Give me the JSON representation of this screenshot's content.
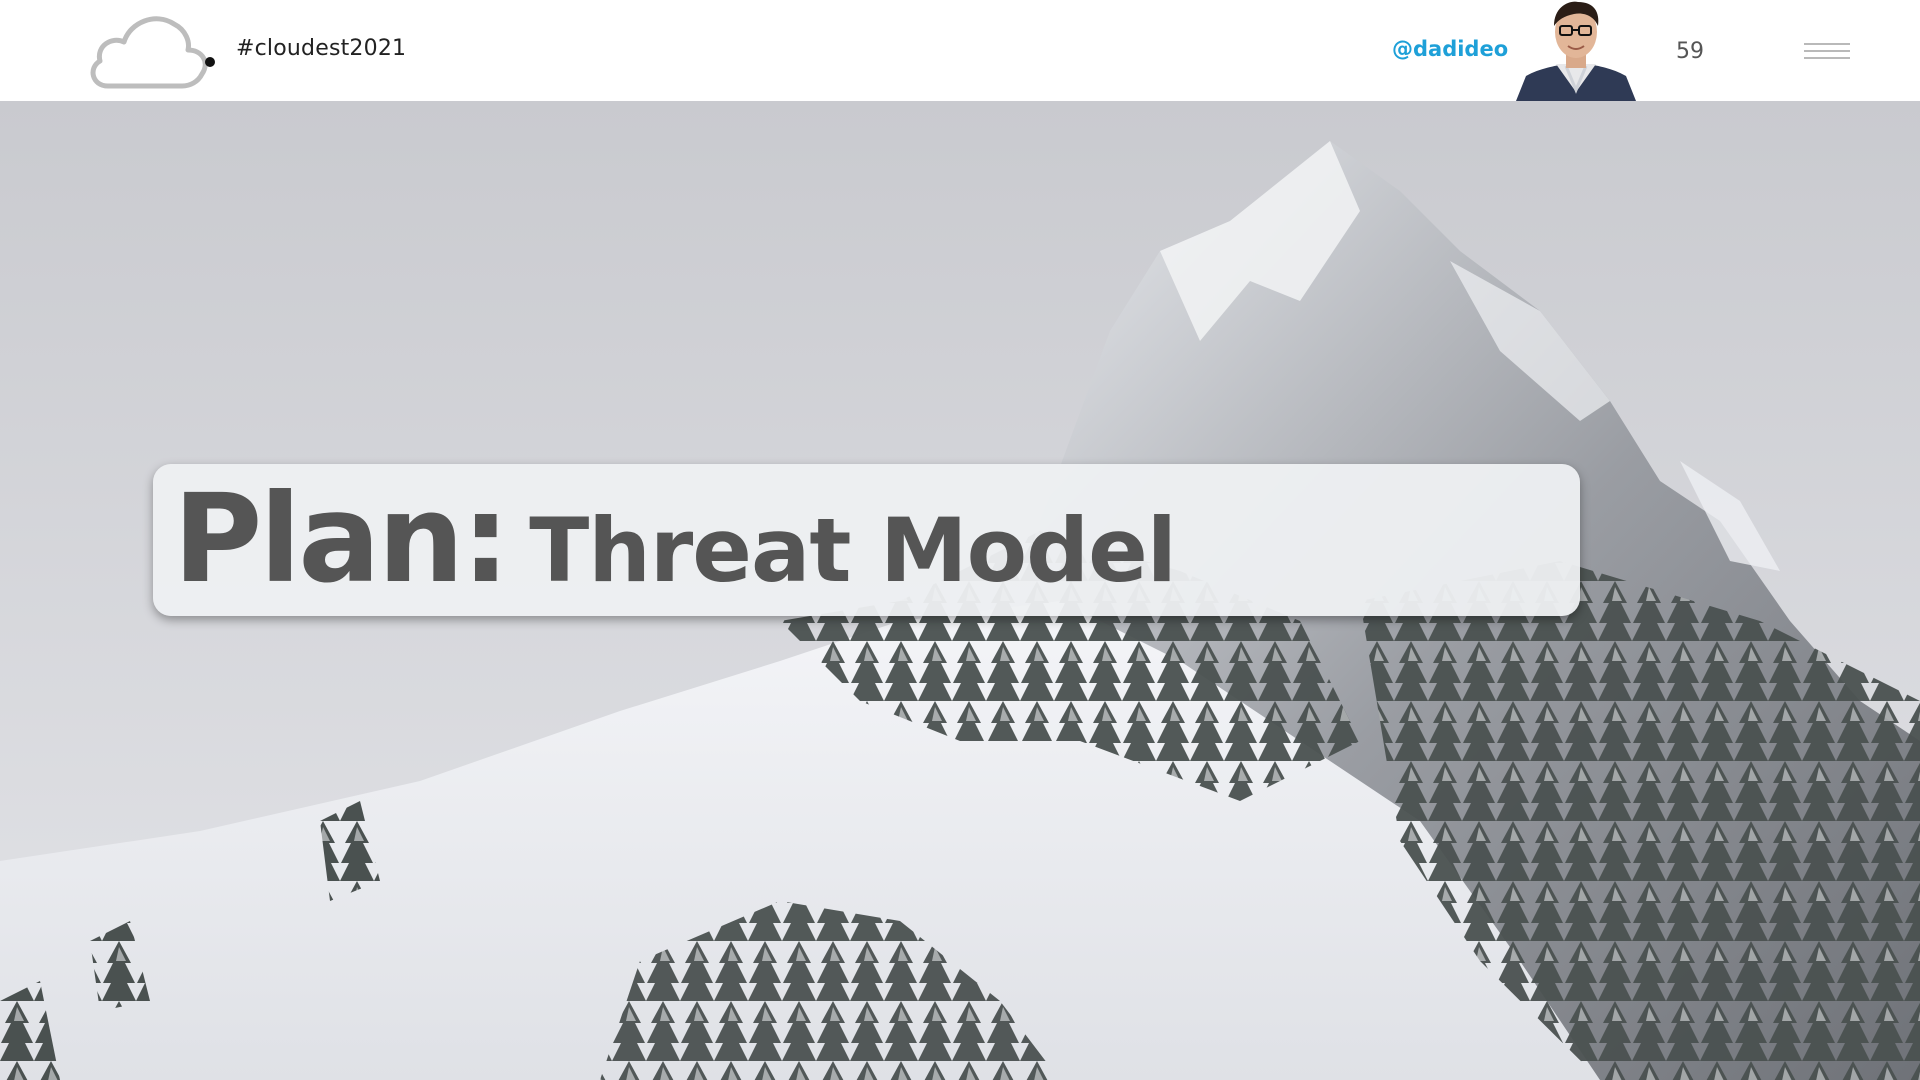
{
  "header": {
    "hashtag": "#cloudest2021",
    "handle": "@dadideo",
    "page_number": "59",
    "logo_icon": "cloud-logo-icon",
    "menu_icon": "hamburger-menu-icon"
  },
  "slide": {
    "title_main": "Plan:",
    "title_sub": "Threat Model"
  },
  "colors": {
    "handle": "#1ea0d8",
    "title_text": "#555555",
    "card_bg": "#eef0f2"
  }
}
